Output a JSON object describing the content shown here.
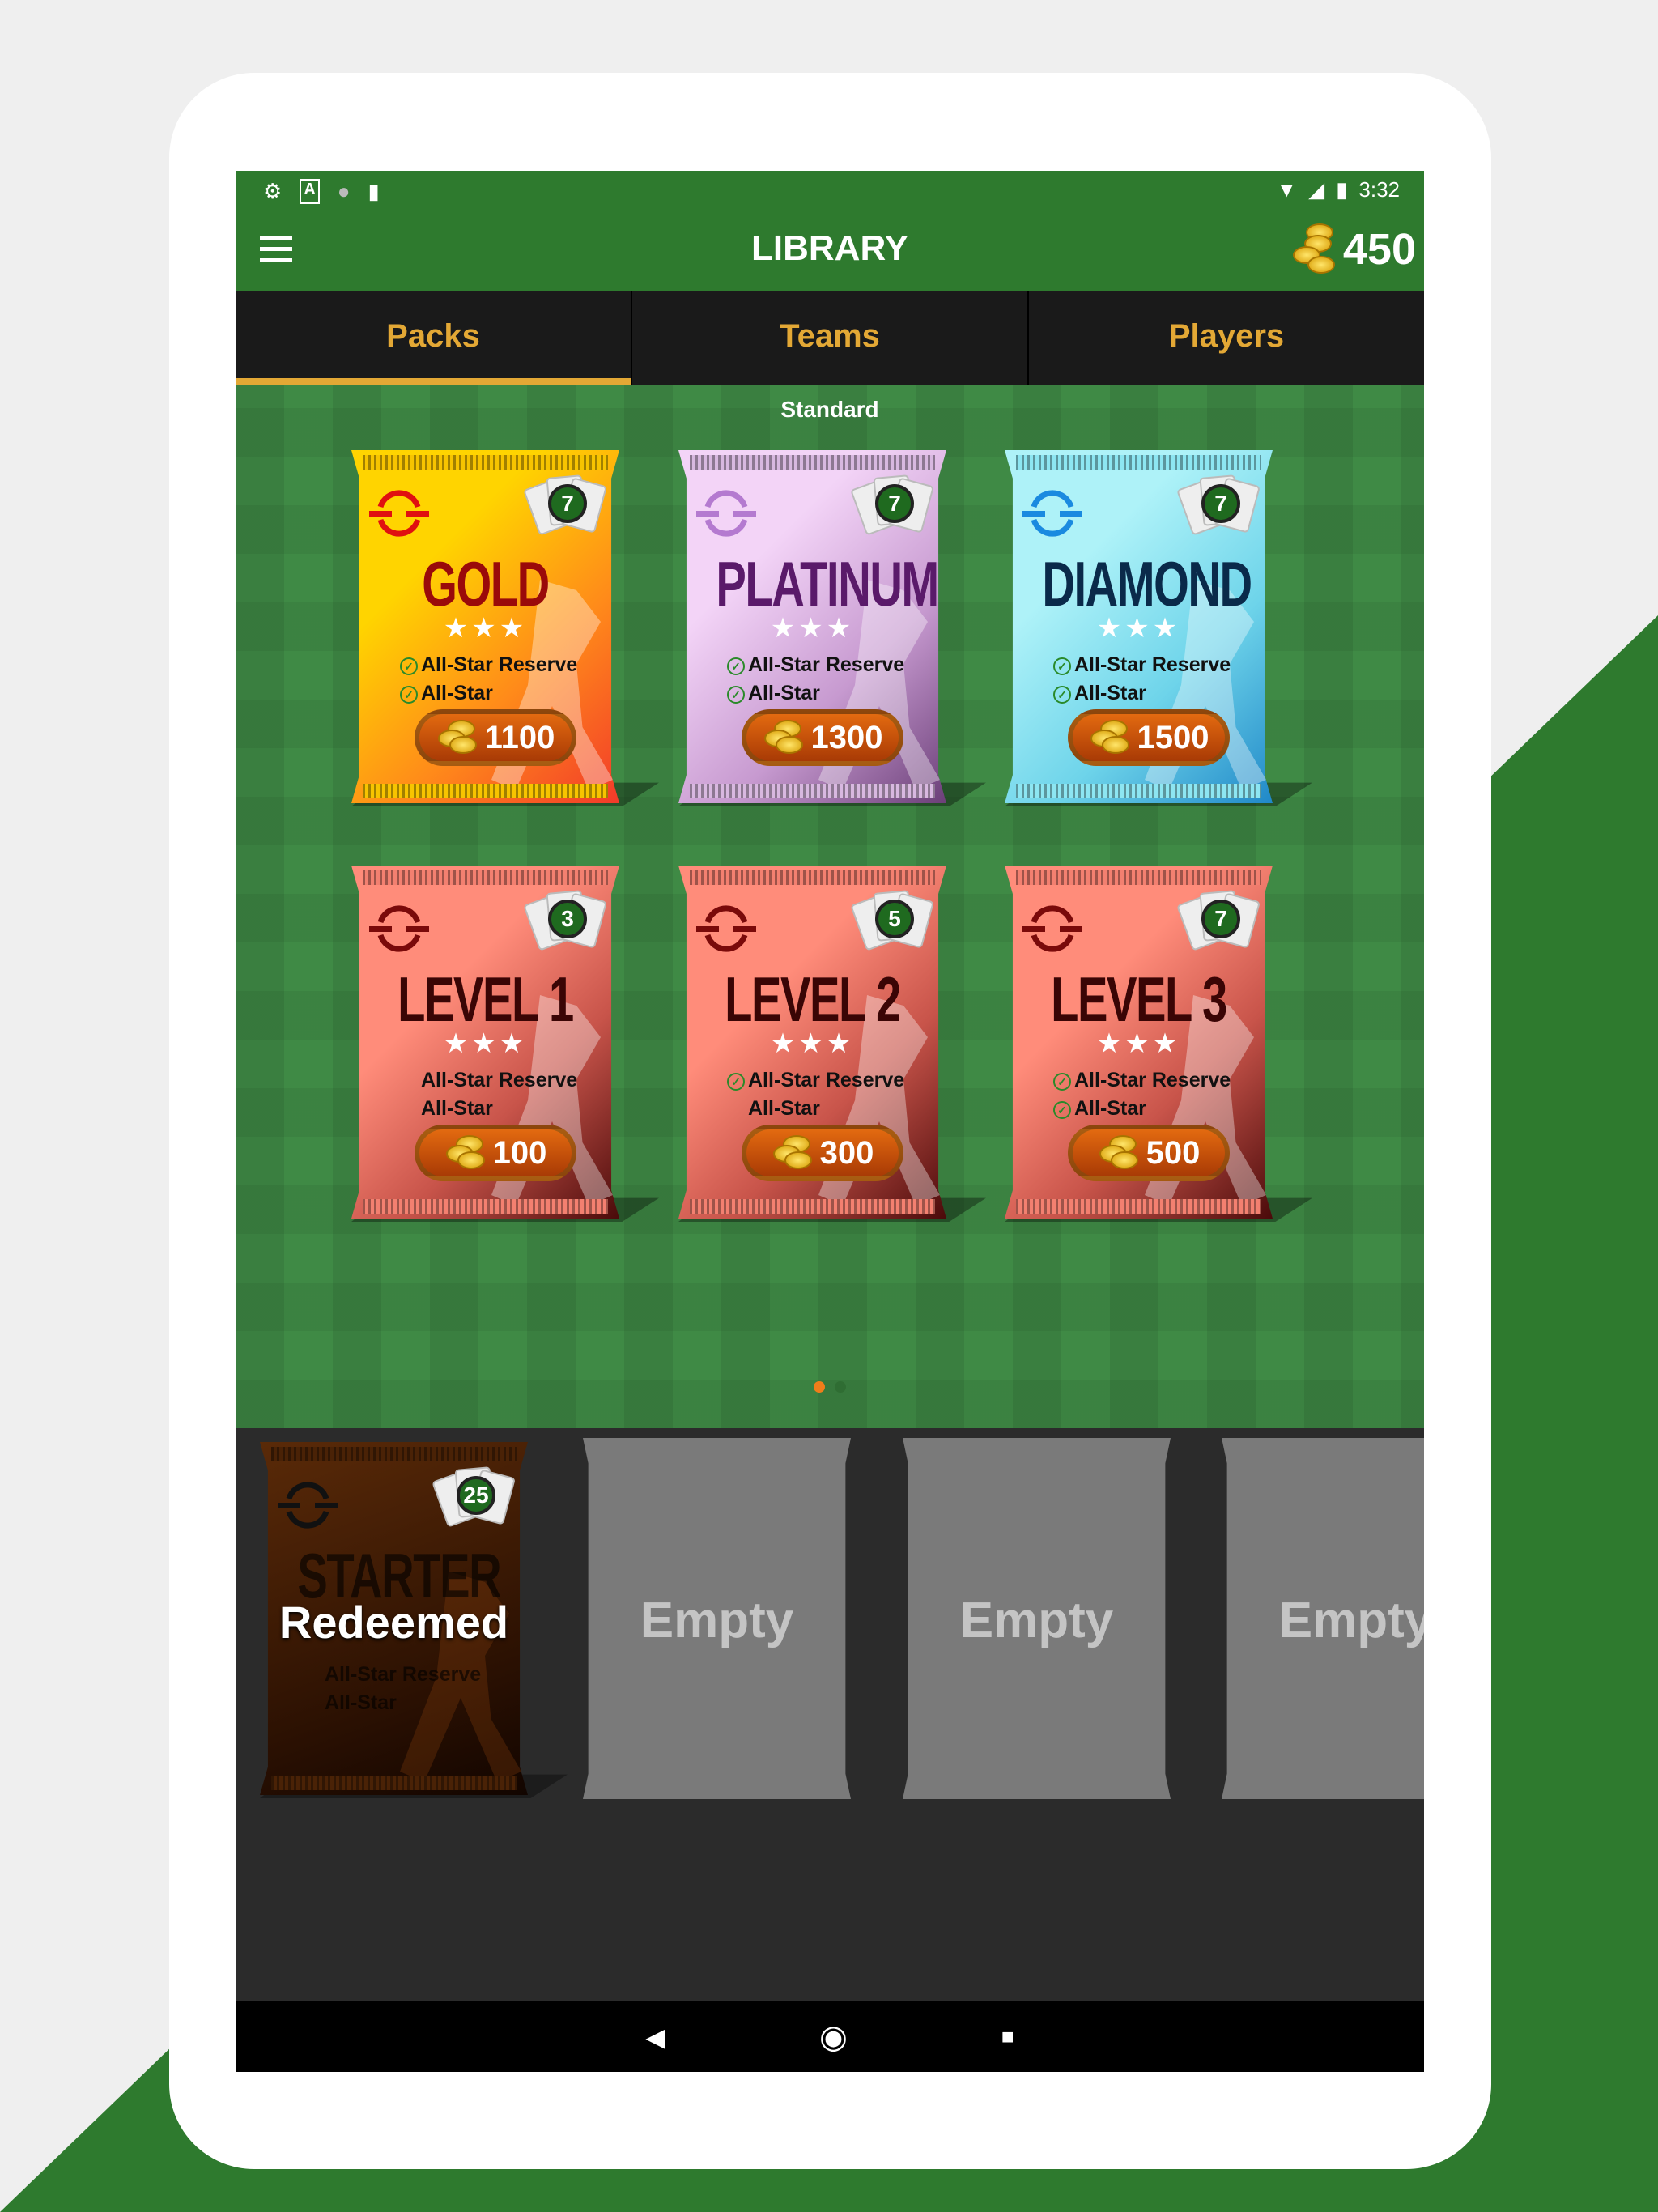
{
  "colors": {
    "brand_green": "#2e7a2e",
    "tab_accent": "#e3a835",
    "field_green": "#3f8a45",
    "price_orange": "#e36a10"
  },
  "status_bar": {
    "left_icons": [
      "settings-icon",
      "a-icon",
      "circle-icon",
      "sd-card-icon"
    ],
    "right_icons": [
      "wifi-icon",
      "signal-icon",
      "battery-icon"
    ],
    "time": "3:32"
  },
  "app_bar": {
    "menu_icon": "hamburger-menu-icon",
    "title": "LIBRARY",
    "coin_icon": "coin-stack-icon",
    "coins": "450"
  },
  "tabs": [
    {
      "label": "Packs",
      "active": true
    },
    {
      "label": "Teams",
      "active": false
    },
    {
      "label": "Players",
      "active": false
    }
  ],
  "section_title": "Standard",
  "packs": [
    {
      "name": "GOLD",
      "stars": "★★★",
      "cards": "7",
      "price": "1100",
      "features": [
        {
          "label": "All-Star Reserve",
          "checked": true
        },
        {
          "label": "All-Star",
          "checked": true
        }
      ],
      "bg": "linear-gradient(135deg,#ffd400 30%,#ff8a1a 65%,#f23a2a)",
      "title_color": "#9a0a0a",
      "logo_color": "#e01010",
      "top": "#f7c400"
    },
    {
      "name": "PLATINUM",
      "stars": "★★★",
      "cards": "7",
      "price": "1300",
      "features": [
        {
          "label": "All-Star Reserve",
          "checked": true
        },
        {
          "label": "All-Star",
          "checked": true
        }
      ],
      "bg": "linear-gradient(135deg,#f3d4f7 30%,#c79ad0 65%,#6b3f78)",
      "title_color": "#5a1a6a",
      "logo_color": "#b47ad0",
      "top": "#d8b8e0"
    },
    {
      "name": "DIAMOND",
      "stars": "★★★",
      "cards": "7",
      "price": "1500",
      "features": [
        {
          "label": "All-Star Reserve",
          "checked": true
        },
        {
          "label": "All-Star",
          "checked": true
        }
      ],
      "bg": "linear-gradient(135deg,#aef2f8 30%,#6ed4ea 65%,#2088c8)",
      "title_color": "#0a2a4a",
      "logo_color": "#1a8ae0",
      "top": "#8de6f2"
    },
    {
      "name": "LEVEL 1",
      "stars": "★★★",
      "cards": "3",
      "price": "100",
      "features": [
        {
          "label": "All-Star Reserve",
          "checked": false
        },
        {
          "label": "All-Star",
          "checked": false
        }
      ],
      "bg": "linear-gradient(135deg,#ff8c7a 35%,#c8544a 65%,#4a0a0a)",
      "title_color": "#3a0505",
      "logo_color": "#7a0a0a",
      "top": "#f38070"
    },
    {
      "name": "LEVEL 2",
      "stars": "★★★",
      "cards": "5",
      "price": "300",
      "features": [
        {
          "label": "All-Star Reserve",
          "checked": true
        },
        {
          "label": "All-Star",
          "checked": false
        }
      ],
      "bg": "linear-gradient(135deg,#ff8c7a 35%,#c8544a 65%,#4a0a0a)",
      "title_color": "#3a0505",
      "logo_color": "#7a0a0a",
      "top": "#f38070"
    },
    {
      "name": "LEVEL 3",
      "stars": "★★★",
      "cards": "7",
      "price": "500",
      "features": [
        {
          "label": "All-Star Reserve",
          "checked": true
        },
        {
          "label": "All-Star",
          "checked": true
        }
      ],
      "bg": "linear-gradient(135deg,#ff8c7a 35%,#c8544a 65%,#4a0a0a)",
      "title_color": "#3a0505",
      "logo_color": "#7a0a0a",
      "top": "#f38070"
    }
  ],
  "pagination": {
    "pages": 2,
    "current": 1
  },
  "tray": {
    "redeemed": {
      "name": "STARTER",
      "cards": "25",
      "status": "Redeemed",
      "features": [
        {
          "label": "All-Star Reserve"
        },
        {
          "label": "All-Star"
        }
      ]
    },
    "empty_slots": [
      "Empty",
      "Empty",
      "Empty"
    ]
  },
  "nav_bar": {
    "icons": [
      "back-icon",
      "home-icon",
      "recents-icon"
    ]
  }
}
